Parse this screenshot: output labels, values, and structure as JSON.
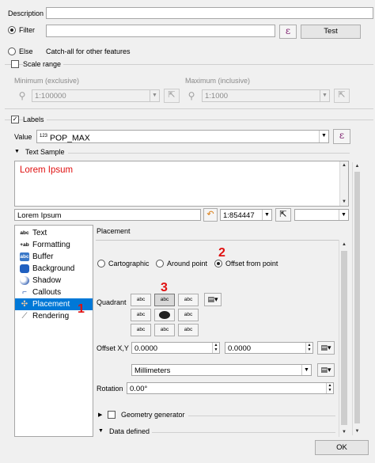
{
  "description": {
    "label": "Description",
    "value": ""
  },
  "filter": {
    "label": "Filter",
    "value": "",
    "test_label": "Test",
    "expr_icon": "ε"
  },
  "else": {
    "label": "Else",
    "text": "Catch-all for other features"
  },
  "scale_range": {
    "label": "Scale range",
    "min_label": "Minimum (exclusive)",
    "max_label": "Maximum (inclusive)",
    "min_value": "1:100000",
    "max_value": "1:1000"
  },
  "labels": {
    "label": "Labels",
    "value_label": "Value",
    "value_prefix": "123",
    "value": "POP_MAX",
    "expr_icon": "ε"
  },
  "text_sample": {
    "label": "Text Sample",
    "preview": "Lorem Ipsum",
    "preview_color": "#e01010",
    "input": "Lorem Ipsum",
    "scale": "1:854447"
  },
  "sections": {
    "items": [
      {
        "label": "Text",
        "icon": "abc"
      },
      {
        "label": "Formatting",
        "icon": "+ab"
      },
      {
        "label": "Buffer",
        "icon": "abc"
      },
      {
        "label": "Background",
        "icon": "bg"
      },
      {
        "label": "Shadow",
        "icon": "shadow"
      },
      {
        "label": "Callouts",
        "icon": "callout"
      },
      {
        "label": "Placement",
        "icon": "placement"
      },
      {
        "label": "Rendering",
        "icon": "brush"
      }
    ],
    "selected": "Placement"
  },
  "placement": {
    "title": "Placement",
    "modes": [
      "Cartographic",
      "Around point",
      "Offset from point"
    ],
    "selected_mode": "Offset from point",
    "quadrant_label": "Quadrant",
    "quadrant_btn": "abc",
    "offset_label": "Offset X,Y",
    "offset_x": "0.0000",
    "offset_y": "0.0000",
    "units": "Millimeters",
    "rotation_label": "Rotation",
    "rotation": "0.00°",
    "geometry_generator": "Geometry generator",
    "data_defined": "Data defined"
  },
  "annotations": {
    "one": "1",
    "two": "2",
    "three": "3"
  },
  "ok_label": "OK"
}
